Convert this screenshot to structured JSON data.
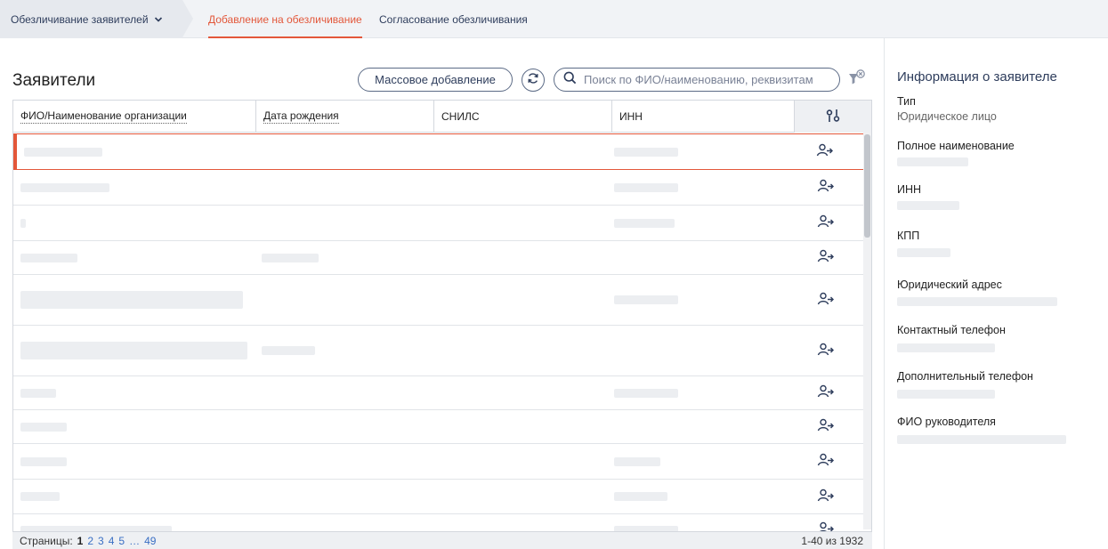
{
  "topbar": {
    "crumb_label": "Обезличивание заявителей",
    "tabs": [
      {
        "label": "Добавление на обезличивание",
        "active": true
      },
      {
        "label": "Согласование обезличивания",
        "active": false
      }
    ],
    "accent_color": "#e3573a"
  },
  "main": {
    "title": "Заявители",
    "mass_add_label": "Массовое добавление",
    "search_placeholder": "Поиск по ФИО/наименованию, реквизитам"
  },
  "table": {
    "columns": [
      "ФИО/Наименование организации",
      "Дата рождения",
      "СНИЛС",
      "ИНН"
    ],
    "settings_icon": "column-settings-icon",
    "row_action_icon": "user-arrow-icon",
    "rows": [
      {
        "name": "",
        "birth": "",
        "snils": "",
        "inn": "",
        "selected": true
      },
      {
        "name": "",
        "birth": "",
        "snils": "",
        "inn": ""
      },
      {
        "name": "",
        "birth": "",
        "snils": "",
        "inn": ""
      },
      {
        "name": "",
        "birth": "",
        "snils": "",
        "inn": ""
      },
      {
        "name": "",
        "birth": "",
        "snils": "",
        "inn": ""
      },
      {
        "name": "",
        "birth": "",
        "snils": "",
        "inn": ""
      },
      {
        "name": "",
        "birth": "",
        "snils": "",
        "inn": ""
      },
      {
        "name": "",
        "birth": "",
        "snils": "",
        "inn": ""
      },
      {
        "name": "",
        "birth": "",
        "snils": "",
        "inn": ""
      },
      {
        "name": "",
        "birth": "",
        "snils": "",
        "inn": ""
      },
      {
        "name": "",
        "birth": "",
        "snils": "",
        "inn": ""
      }
    ]
  },
  "footer": {
    "pages_label": "Страницы:",
    "pages": [
      "1",
      "2",
      "3",
      "4",
      "5"
    ],
    "ellipsis": "…",
    "last_page": "49",
    "range_label": "1-40 из 1932"
  },
  "info": {
    "title": "Информация о заявителе",
    "fields": [
      {
        "label": "Тип",
        "value": "Юридическое лицо"
      },
      {
        "label": "Полное наименование",
        "value": ""
      },
      {
        "label": "ИНН",
        "value": ""
      },
      {
        "label": "КПП",
        "value": ""
      },
      {
        "label": "Юридический адрес",
        "value": ""
      },
      {
        "label": "Контактный телефон",
        "value": ""
      },
      {
        "label": "Дополнительный телефон",
        "value": ""
      },
      {
        "label": "ФИО руководителя",
        "value": ""
      }
    ]
  }
}
